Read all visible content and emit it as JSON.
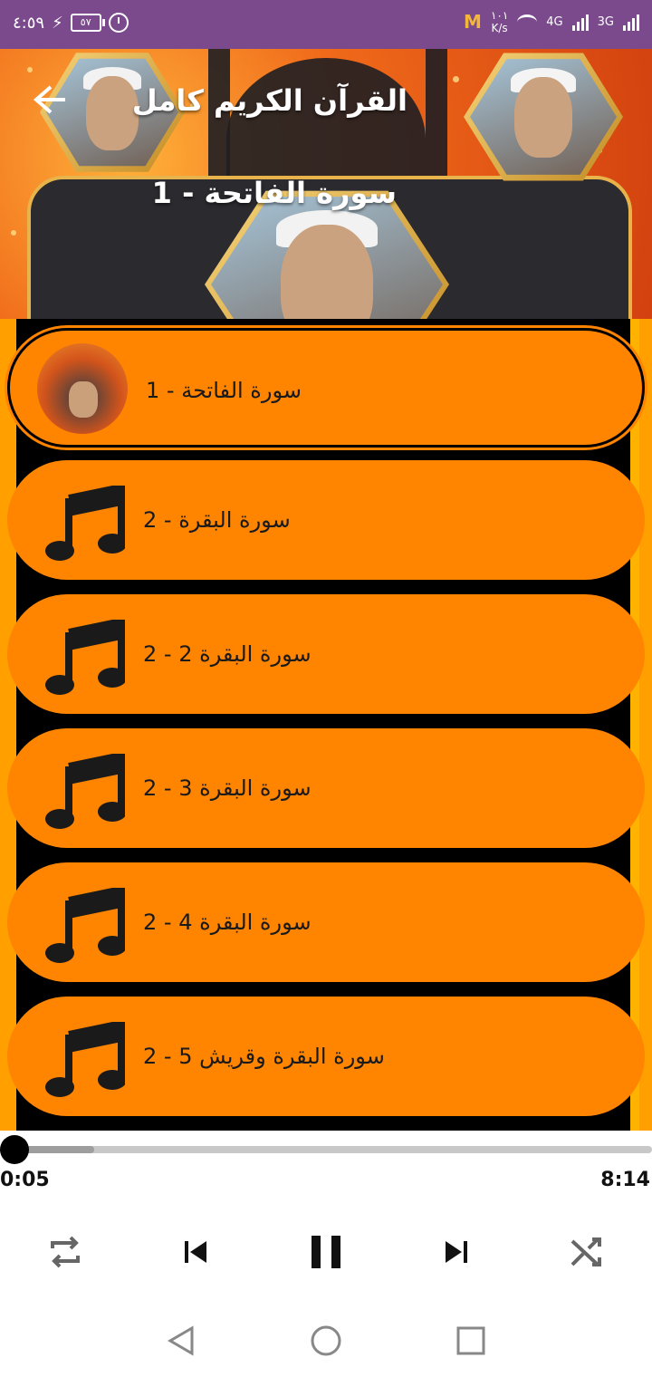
{
  "status_bar": {
    "time": "٤:٥٩",
    "battery": "٥٧",
    "network_speed_value": "١٠١",
    "network_speed_unit": "K/s",
    "network_1": "4G",
    "network_2": "3G"
  },
  "header": {
    "title": "القرآن الكريم كامل",
    "now_playing": "سورة الفاتحة - 1"
  },
  "tracks": [
    {
      "label": "سورة الفاتحة - 1",
      "active": true
    },
    {
      "label": "سورة البقرة  - 2",
      "active": false
    },
    {
      "label": "سورة البقرة  2 - 2",
      "active": false
    },
    {
      "label": "سورة البقرة 3  - 2",
      "active": false
    },
    {
      "label": "سورة البقرة 4  - 2",
      "active": false
    },
    {
      "label": "سورة البقرة وقريش  5 - 2",
      "active": false
    }
  ],
  "player": {
    "elapsed": "0:05",
    "duration": "8:14",
    "progress_fraction": 0.01
  },
  "colors": {
    "status_bar": "#7a4a8c",
    "item_bg": "#ff8400",
    "list_bg": "#000000",
    "edge": "#ffa000"
  }
}
